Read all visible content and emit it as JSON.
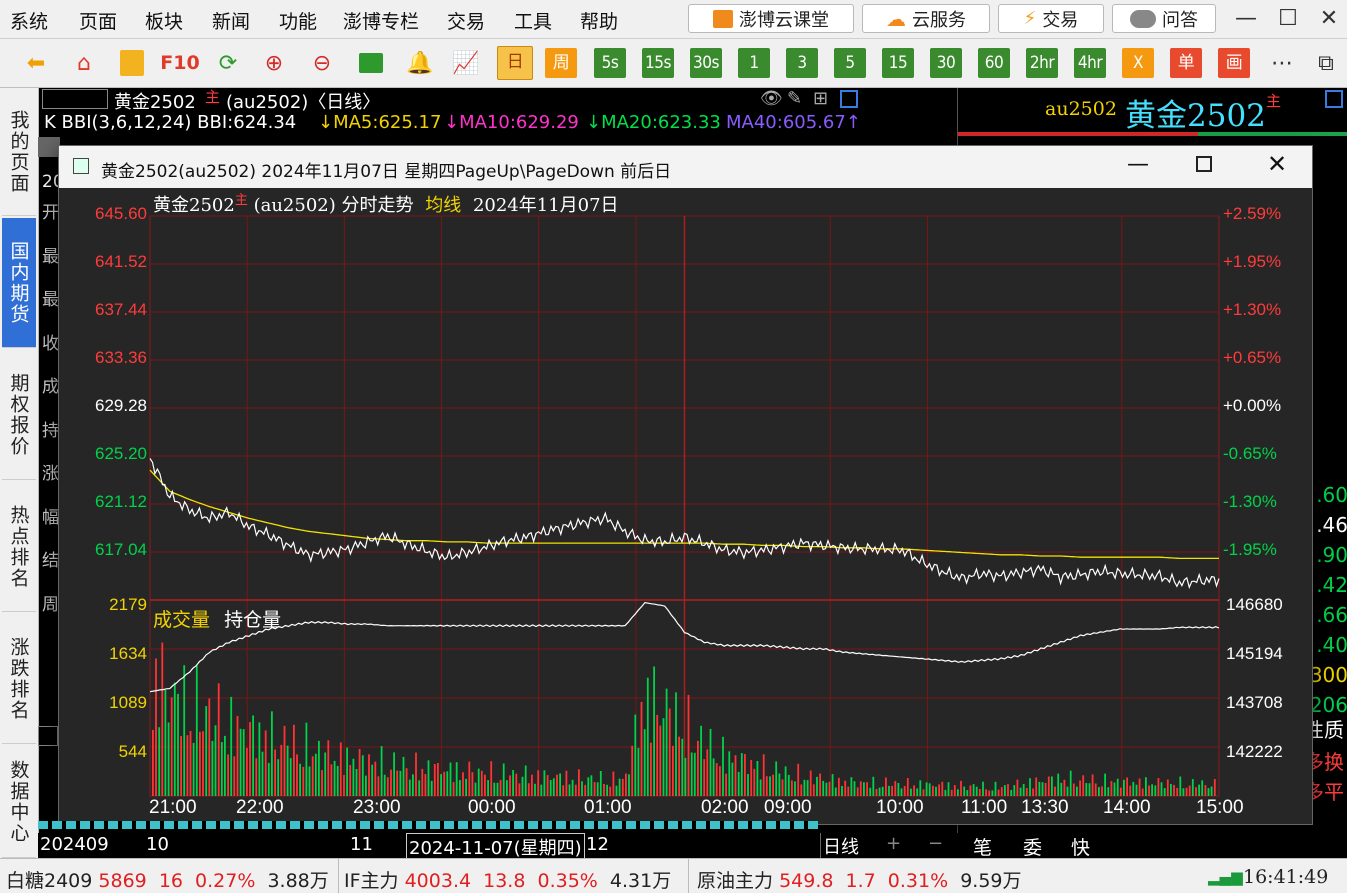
{
  "menu": [
    "系统",
    "页面",
    "板块",
    "新闻",
    "功能",
    "澎博专栏",
    "交易",
    "工具",
    "帮助"
  ],
  "promo": {
    "course": "澎博云课堂",
    "cloud": "云服务",
    "trade": "交易",
    "qa": "问答"
  },
  "window_controls": {
    "min": "—",
    "max": "☐",
    "close": "✕"
  },
  "toolbar": {
    "f10": "F10",
    "periods": [
      "日",
      "周",
      "5s",
      "15s",
      "30s",
      "1",
      "3",
      "5",
      "15",
      "30",
      "60",
      "2hr",
      "4hr",
      "X",
      "单",
      "画"
    ],
    "more": "⋯"
  },
  "sidebar": [
    "我的页面",
    "国内期货",
    "期权报价",
    "热点排名",
    "涨跌排名",
    "数据中心"
  ],
  "bg_chart": {
    "title_name": "黄金2502",
    "title_main": "主",
    "title_code": "(au2502)〈日线〉",
    "indicator": "K BBI(3,6,12,24) BBI:624.34",
    "ma5": "↓MA5:625.17",
    "ma10": "↓MA10:629.29",
    "ma20": "↓MA20:623.33",
    "ma40": "MA40:605.67↑",
    "left_labels": [
      "开",
      "最",
      "最",
      "收",
      "成",
      "持",
      "涨",
      "幅",
      "结",
      "周"
    ],
    "year_label": "20"
  },
  "right_panel": {
    "code": "au2502",
    "name": "黄金2502",
    "main": "主",
    "values": [
      ".60",
      ".46",
      ".90",
      ".42",
      ".66",
      ".40",
      "300",
      ".206"
    ],
    "bottom_texts": [
      "性质",
      "多换",
      "多平"
    ]
  },
  "modal": {
    "title": "黄金2502(au2502) 2024年11月07日 星期四PageUp\\PageDown 前后日",
    "chart_name": "黄金2502",
    "chart_main": "主",
    "chart_code": "(au2502) 分时走势",
    "avg_label": "均线",
    "date": "2024年11月07日",
    "vol_label": "成交量",
    "oi_label": "持仓量"
  },
  "chart_data": {
    "type": "line",
    "title": "黄金2502 (au2502) 分时走势",
    "price_axis": {
      "labels": [
        "645.60",
        "641.52",
        "637.44",
        "633.36",
        "629.28",
        "625.20",
        "621.12",
        "617.04"
      ],
      "range": [
        617.04,
        645.6
      ],
      "prev_close": 629.28
    },
    "pct_axis": [
      "+2.59%",
      "+1.95%",
      "+1.30%",
      "+0.65%",
      "+0.00%",
      "-0.65%",
      "-1.30%",
      "-1.95%"
    ],
    "volume_axis": [
      "2179",
      "1634",
      "1089",
      "544"
    ],
    "oi_axis": [
      "146680",
      "145194",
      "143708",
      "142222"
    ],
    "x_ticks": [
      "21:00",
      "22:00",
      "23:00",
      "00:00",
      "01:00",
      "02:00",
      "09:00",
      "10:00",
      "11:00",
      "13:30",
      "14:00",
      "15:00"
    ],
    "price_series": [
      625.0,
      621.8,
      620.6,
      619.9,
      620.4,
      619.2,
      618.5,
      617.6,
      616.8,
      617.0,
      617.3,
      617.9,
      618.4,
      617.7,
      617.1,
      616.6,
      617.0,
      617.5,
      618.0,
      618.3,
      618.8,
      619.2,
      619.6,
      619.9,
      618.8,
      618.0,
      617.9,
      618.3,
      617.8,
      617.2,
      617.0,
      617.2,
      617.5,
      617.8,
      617.6,
      617.4,
      617.3,
      617.3,
      617.2,
      616.2,
      615.4,
      614.8,
      615.2,
      615.0,
      615.3,
      615.6,
      614.9,
      615.1,
      615.4,
      615.2,
      615.1,
      615.0,
      614.4,
      614.6,
      614.7
    ],
    "avg_series": [
      624.0,
      622.2,
      621.5,
      620.9,
      620.4,
      619.9,
      619.5,
      619.1,
      618.8,
      618.6,
      618.4,
      618.2,
      618.1,
      618.0,
      618.0,
      617.9,
      617.9,
      617.8,
      617.8,
      617.8,
      617.8,
      617.8,
      617.8,
      617.8,
      617.8,
      617.8,
      617.8,
      617.8,
      617.8,
      617.7,
      617.7,
      617.6,
      617.6,
      617.5,
      617.5,
      617.4,
      617.4,
      617.3,
      617.3,
      617.2,
      617.1,
      617.0,
      616.9,
      616.8,
      616.8,
      616.7,
      616.7,
      616.6,
      616.6,
      616.6,
      616.6,
      616.6,
      616.5,
      616.5,
      616.5
    ],
    "oi_series": [
      143900,
      144000,
      144500,
      145100,
      145400,
      145600,
      145800,
      145900,
      146000,
      146000,
      145950,
      145950,
      145900,
      145900,
      145900,
      145900,
      145900,
      145900,
      145900,
      145900,
      145900,
      145900,
      145900,
      145900,
      145900,
      146600,
      146500,
      145700,
      145400,
      145300,
      145300,
      145300,
      145250,
      145200,
      145200,
      145100,
      145050,
      145000,
      144950,
      144900,
      144850,
      144800,
      144850,
      144900,
      145000,
      145200,
      145400,
      145600,
      145700,
      145800,
      145800,
      145800,
      145850,
      145850,
      145850
    ],
    "volume_profile": [
      2100,
      1700,
      1500,
      1400,
      1200,
      1100,
      1000,
      900,
      800,
      700,
      650,
      600,
      550,
      500,
      480,
      450,
      420,
      400,
      380,
      360,
      340,
      320,
      300,
      290,
      280,
      1700,
      1500,
      1200,
      900,
      700,
      600,
      500,
      400,
      350,
      300,
      250,
      230,
      220,
      210,
      200,
      190,
      180,
      170,
      160,
      200,
      250,
      300,
      280,
      260,
      250,
      240,
      230,
      220,
      210,
      200
    ]
  },
  "bottom_bar": {
    "b1": "202409",
    "b2": "10",
    "b3": "11",
    "b4": "2024-11-07(星期四)",
    "b5": "12",
    "daily": "日线",
    "plus": "+",
    "minus": "−",
    "tab1": "笔",
    "tab2": "委",
    "tab3": "快"
  },
  "ticker": {
    "i1_name": "白糖2409",
    "i1_price": "5869",
    "i1_chg": "16",
    "i1_pct": "0.27%",
    "i1_vol": "3.88万",
    "i2_name": "IF主力",
    "i2_price": "4003.4",
    "i2_chg": "13.8",
    "i2_pct": "0.35%",
    "i2_vol": "4.31万",
    "i3_name": "原油主力",
    "i3_price": "549.8",
    "i3_chg": "1.7",
    "i3_pct": "0.31%",
    "i3_vol": "9.59万",
    "time": "16:41:49"
  },
  "colors": {
    "up": "#ff3b3b",
    "down": "#00d24a",
    "accent": "#f2d300",
    "line": "#ffffff"
  }
}
